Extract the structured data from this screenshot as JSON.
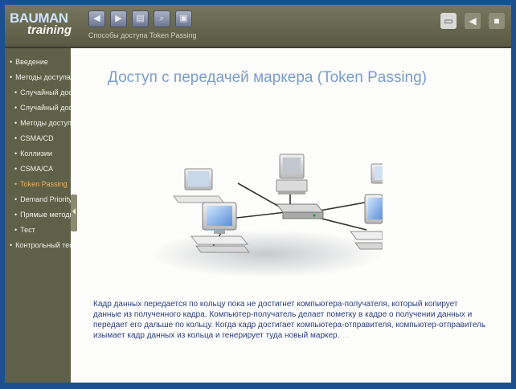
{
  "app": {
    "logo_line1": "BAUMAN",
    "logo_line2": "training"
  },
  "toolbar": {
    "buttons": [
      {
        "icon": "back-icon",
        "glyph": "◀"
      },
      {
        "icon": "forward-icon",
        "glyph": "▶"
      },
      {
        "icon": "book-icon",
        "glyph": "▤"
      },
      {
        "icon": "search-icon",
        "glyph": "⌕"
      },
      {
        "icon": "print-icon",
        "glyph": "▣"
      }
    ],
    "breadcrumb": "Способы доступа  Token Passing"
  },
  "header_right": [
    {
      "icon": "monitor-icon",
      "glyph": "▭"
    },
    {
      "icon": "sound-icon",
      "glyph": "◀"
    },
    {
      "icon": "exit-icon",
      "glyph": "■"
    }
  ],
  "sidebar": {
    "items": [
      {
        "label": "Введение",
        "level": 0
      },
      {
        "label": "Методы доступа",
        "level": 0
      },
      {
        "label": "Случайный доступ",
        "level": 1
      },
      {
        "label": "Случайный доступ",
        "level": 1
      },
      {
        "label": "Методы доступа",
        "level": 1
      },
      {
        "label": "CSMA/CD",
        "level": 1
      },
      {
        "label": "Коллизии",
        "level": 1
      },
      {
        "label": "CSMA/CA",
        "level": 1
      },
      {
        "label": "Token Passing",
        "level": 1,
        "active": true
      },
      {
        "label": "Demand Priority",
        "level": 1
      },
      {
        "label": "Прямые методы",
        "level": 1
      },
      {
        "label": "Тест",
        "level": 1
      },
      {
        "label": "Контрольный тест",
        "level": 0
      }
    ]
  },
  "content": {
    "title": "Доступ с передачей маркера (Token Passing)",
    "paragraph": "Кадр данных передается по кольцу пока не достигнет компьютера-получателя, который копирует данные из полученного кадра. Компьютер-получатель делает пометку в кадре о получении данных и передает его дальше по кольцу. Когда кадр достигает компьютера-отправителя, компьютер-отправитель изымает кадр данных из кольца и генерирует туда новый маркер.",
    "paragraph_tail": "…"
  },
  "colors": {
    "accent": "#7a9dcc",
    "active_item": "#f2b05a",
    "sidebar_bg": "#5e6148",
    "header_bg": "#6a6a54",
    "text": "#2a3d80"
  }
}
